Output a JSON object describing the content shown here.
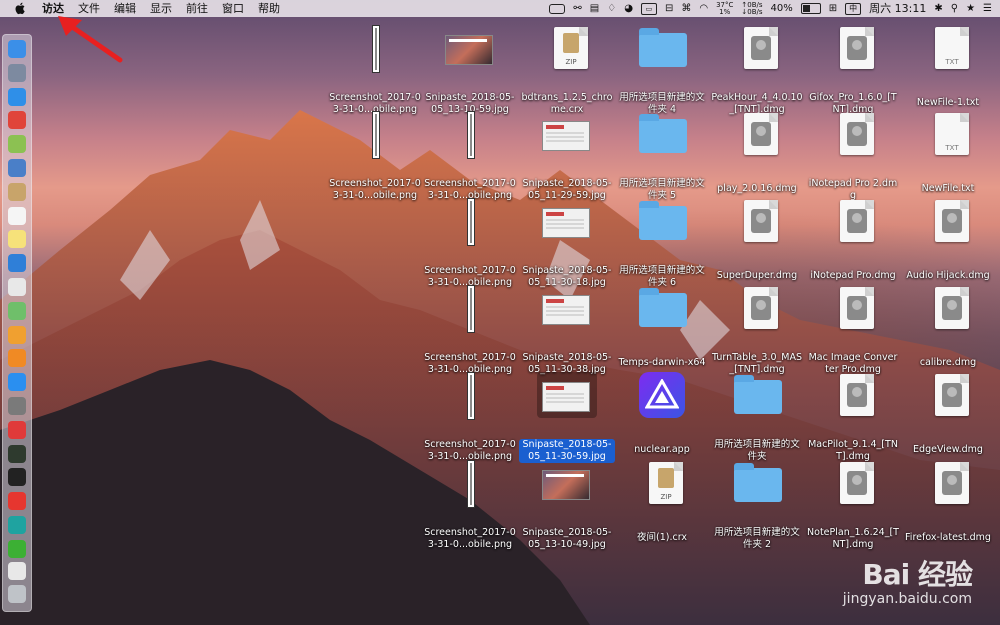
{
  "menubar": {
    "app_name": "访达",
    "menus": [
      "文件",
      "编辑",
      "显示",
      "前往",
      "窗口",
      "帮助"
    ],
    "status": {
      "temp_top": "37°C",
      "temp_bottom": "1%",
      "net_up": "0B/s",
      "net_down": "0B/s",
      "battery_percent": "40%",
      "datetime": "周六 13:11",
      "input_box": "中"
    }
  },
  "desktop": {
    "items": [
      {
        "label": "Screenshot_2017-03-31-0...obile.png",
        "type": "tall-screenshot"
      },
      {
        "label": "Snipaste_2018-05-05_13-10-59.jpg",
        "type": "photo-thumb"
      },
      {
        "label": "bdtrans_1.2.5_chrome.crx",
        "type": "zip",
        "tag": "ZIP"
      },
      {
        "label": "用所选项目新建的文件夹 4",
        "type": "folder"
      },
      {
        "label": "PeakHour_4_4.0.10_[TNT].dmg",
        "type": "dmg"
      },
      {
        "label": "Gifox_Pro_1.6.0_[TNT].dmg",
        "type": "dmg"
      },
      {
        "label": "NewFile-1.txt",
        "type": "txt",
        "tag": "TXT"
      },
      {
        "label": "Screenshot_2017-03-31-0...obile.png",
        "type": "tall-screenshot"
      },
      {
        "label": "Screenshot_2017-03-31-0...obile.png",
        "type": "tall-screenshot"
      },
      {
        "label": "Snipaste_2018-05-05_11-29-59.jpg",
        "type": "doc-thumb"
      },
      {
        "label": "用所选项目新建的文件夹 5",
        "type": "folder"
      },
      {
        "label": "play_2.0.16.dmg",
        "type": "dmg"
      },
      {
        "label": "iNotepad Pro 2.dmg",
        "type": "dmg"
      },
      {
        "label": "NewFile.txt",
        "type": "txt",
        "tag": "TXT"
      },
      {
        "label": "Screenshot_2017-03-31-0...obile.png",
        "type": "tall-screenshot"
      },
      {
        "label": "Snipaste_2018-05-05_11-30-18.jpg",
        "type": "doc-thumb"
      },
      {
        "label": "用所选项目新建的文件夹 6",
        "type": "folder"
      },
      {
        "label": "SuperDuper.dmg",
        "type": "dmg"
      },
      {
        "label": "iNotepad Pro.dmg",
        "type": "dmg"
      },
      {
        "label": "Audio Hijack.dmg",
        "type": "dmg"
      },
      {
        "label": "Screenshot_2017-03-31-0...obile.png",
        "type": "tall-screenshot"
      },
      {
        "label": "Snipaste_2018-05-05_11-30-38.jpg",
        "type": "doc-thumb"
      },
      {
        "label": "Temps-darwin-x64",
        "type": "folder"
      },
      {
        "label": "TurnTable_3.0_MAS_[TNT].dmg",
        "type": "dmg"
      },
      {
        "label": "Mac Image Converter Pro.dmg",
        "type": "dmg"
      },
      {
        "label": "calibre.dmg",
        "type": "dmg"
      },
      {
        "label": "Screenshot_2017-03-31-0...obile.png",
        "type": "tall-screenshot"
      },
      {
        "label": "Snipaste_2018-05-05_11-30-59.jpg",
        "type": "doc-thumb",
        "selected": true
      },
      {
        "label": "nuclear.app",
        "type": "app"
      },
      {
        "label": "用所选项目新建的文件夹",
        "type": "folder"
      },
      {
        "label": "MacPilot_9.1.4_[TNT].dmg",
        "type": "dmg"
      },
      {
        "label": "EdgeView.dmg",
        "type": "dmg"
      },
      {
        "label": "Screenshot_2017-03-31-0...obile.png",
        "type": "tall-screenshot"
      },
      {
        "label": "Snipaste_2018-05-05_13-10-49.jpg",
        "type": "photo-thumb"
      },
      {
        "label": "夜间(1).crx",
        "type": "zip",
        "tag": "ZIP"
      },
      {
        "label": "用所选项目新建的文件夹 2",
        "type": "folder"
      },
      {
        "label": "NotePlan_1.6.24_[TNT].dmg",
        "type": "dmg"
      },
      {
        "label": "Firefox-latest.dmg",
        "type": "dmg"
      }
    ]
  },
  "dock": {
    "icons": [
      {
        "name": "finder-icon",
        "color": "#3b8fe8"
      },
      {
        "name": "launchpad-icon",
        "color": "#7d8aa0"
      },
      {
        "name": "safari-icon",
        "color": "#2f8fe8"
      },
      {
        "name": "app-red-icon",
        "color": "#e0443a"
      },
      {
        "name": "android-icon",
        "color": "#8cc152"
      },
      {
        "name": "preview-icon",
        "color": "#4a7fc8"
      },
      {
        "name": "notebook-icon",
        "color": "#c8a46a"
      },
      {
        "name": "calendar-icon",
        "color": "#f5f5f5"
      },
      {
        "name": "notes-icon",
        "color": "#f6e27a"
      },
      {
        "name": "search-app-icon",
        "color": "#2f7fd8"
      },
      {
        "name": "textedit-icon",
        "color": "#e8e8e8"
      },
      {
        "name": "maps-icon",
        "color": "#6fbf6a"
      },
      {
        "name": "photos-icon",
        "color": "#f0a030"
      },
      {
        "name": "books-icon",
        "color": "#f08a24"
      },
      {
        "name": "appstore-icon",
        "color": "#2a8ff0"
      },
      {
        "name": "system-preferences-icon",
        "color": "#7a7a7a"
      },
      {
        "name": "vivaldi-icon",
        "color": "#e03a3a"
      },
      {
        "name": "activity-monitor-icon",
        "color": "#2e3a2e"
      },
      {
        "name": "terminal-icon",
        "color": "#222222"
      },
      {
        "name": "weibo-icon",
        "color": "#e6362f"
      },
      {
        "name": "chat-icon",
        "color": "#1fa3a0"
      },
      {
        "name": "wechat-icon",
        "color": "#3cb034"
      },
      {
        "name": "document-icon",
        "color": "#e8e8e8"
      },
      {
        "name": "trash-icon",
        "color": "#bfc3c8"
      }
    ]
  },
  "watermark": {
    "brand": "Bai 经验",
    "url": "jingyan.baidu.com"
  }
}
